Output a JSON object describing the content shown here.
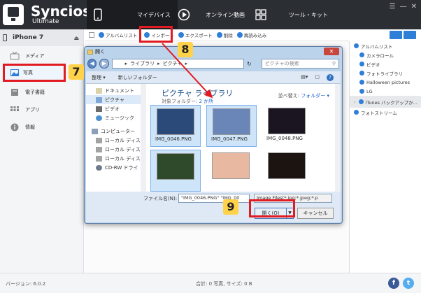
{
  "app": {
    "name": "Syncios",
    "edition": "Ultimate"
  },
  "nav": {
    "device": "マイデバイス",
    "online": "オンライン動画",
    "tools": "ツール・キット"
  },
  "window_controls": [
    "☰",
    "—",
    "✕"
  ],
  "sidebar": {
    "device_name": "iPhone 7",
    "items": [
      {
        "label": "メディア",
        "icon": "media-icon"
      },
      {
        "label": "写真",
        "icon": "photo-icon"
      },
      {
        "label": "電子書籍",
        "icon": "ebook-icon"
      },
      {
        "label": "アプリ",
        "icon": "apps-icon"
      },
      {
        "label": "情報",
        "icon": "info-icon"
      }
    ]
  },
  "toolbar": {
    "album_list": "アルバムリスト",
    "import": "インポート",
    "export": "エクスポート",
    "delete": "削除",
    "reload": "再読み込み"
  },
  "right_panel": {
    "items": [
      {
        "label": "アルバムリスト",
        "level": 0
      },
      {
        "label": "カメラロール",
        "level": 1
      },
      {
        "label": "ビデオ",
        "level": 1
      },
      {
        "label": "フォトライブラリ",
        "level": 1
      },
      {
        "label": "Halloween pictures",
        "level": 1
      },
      {
        "label": "LG",
        "level": 1
      },
      {
        "label": "iTunes バックアップか...",
        "level": 0
      },
      {
        "label": "フォトストリーム",
        "level": 0
      }
    ]
  },
  "dialog": {
    "title": "開く",
    "address": [
      "ライブラリ",
      "ピクチャ"
    ],
    "search_placeholder": "ピクチャの検索",
    "organize": "整理",
    "new_folder": "新しいフォルダー",
    "nav_items": [
      {
        "label": "ドキュメント",
        "level": 0
      },
      {
        "label": "ピクチャ",
        "level": 0,
        "selected": true
      },
      {
        "label": "ビデオ",
        "level": 0
      },
      {
        "label": "ミュージック",
        "level": 0
      },
      {
        "label": "コンピューター",
        "level": 0
      },
      {
        "label": "ローカル ディス",
        "level": 1
      },
      {
        "label": "ローカル ディス",
        "level": 1
      },
      {
        "label": "ローカル ディス",
        "level": 1
      },
      {
        "label": "CD-RW ドライ",
        "level": 1
      }
    ],
    "library_title": "ピクチャ ライブラリ",
    "target_folder_label": "対象フォルダー:",
    "target_folder_count": "2 か所",
    "sort_label": "並べ替え:",
    "sort_value": "フォルダー ▾",
    "thumbnails": [
      {
        "name": "IMG_0046.PNG",
        "selected": true,
        "color": "#2b4a7a"
      },
      {
        "name": "IMG_0047.PNG",
        "selected": true,
        "color": "#6a86b8"
      },
      {
        "name": "IMG_0048.PNG",
        "selected": false,
        "color": "#1a1520"
      },
      {
        "name": "",
        "selected": true,
        "color": "#2f4a2a"
      },
      {
        "name": "",
        "selected": false,
        "color": "#e8b9a0"
      },
      {
        "name": "",
        "selected": false,
        "color": "#1c1410"
      }
    ],
    "filename_label": "ファイル名(N):",
    "filename_value": "\"IMG_0046.PNG\" \"IMG_00",
    "filetype": "Image Files(*.jpg;*.jpeg;*.p",
    "open": "開く(O)",
    "cancel": "キャンセル"
  },
  "callouts": [
    "7",
    "8",
    "9"
  ],
  "status": {
    "version": "バージョン: 6.0.2",
    "summary": "合計: 0 写真, サイズ: 0 B"
  },
  "colors": {
    "topbar": "#2b2e33",
    "accent": "#2f7ed8",
    "highlight": "#e21b23",
    "callout": "#ffd24a"
  }
}
